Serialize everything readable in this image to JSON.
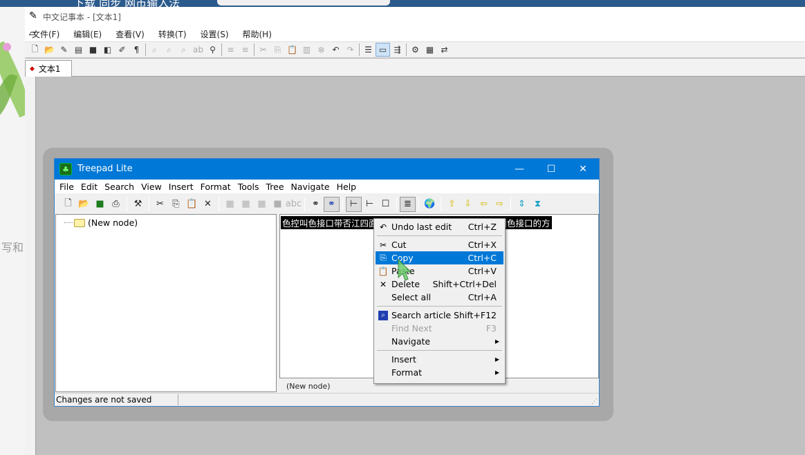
{
  "outer_app": {
    "title": "中文记事本 - [文本1]",
    "menu": [
      "文件(F)",
      "编辑(E)",
      "查看(V)",
      "转换(T)",
      "设置(S)",
      "帮助(H)"
    ],
    "tab_label": "文本1"
  },
  "background": {
    "fragment_left": "写和",
    "fragment_top": "下载    同步    网市输入法"
  },
  "treepad": {
    "title": "Treepad Lite",
    "menu": [
      "File",
      "Edit",
      "Search",
      "View",
      "Insert",
      "Format",
      "Tools",
      "Tree",
      "Navigate",
      "Help"
    ],
    "tree_node": "(New node)",
    "editor_text": "色控叫色接口带否江四面只带否所章只包控附色接口还控叫色接口的方",
    "node_path": "(New node)",
    "status": "Changes are not saved"
  },
  "context_menu": {
    "items": [
      {
        "label": "Undo last edit",
        "shortcut": "Ctrl+Z",
        "icon": "↶"
      },
      {
        "label": "Cut",
        "shortcut": "Ctrl+X",
        "icon": "✂"
      },
      {
        "label": "Copy",
        "shortcut": "Ctrl+C",
        "icon": "⎘"
      },
      {
        "label": "Paste",
        "shortcut": "Ctrl+V",
        "icon": "📋"
      },
      {
        "label": "Delete",
        "shortcut": "Shift+Ctrl+Del",
        "icon": "✕"
      },
      {
        "label": "Select all",
        "shortcut": "Ctrl+A",
        "icon": ""
      },
      {
        "label": "Search article",
        "shortcut": "Shift+F12",
        "icon": "⌕"
      },
      {
        "label": "Find Next",
        "shortcut": "F3",
        "icon": ""
      },
      {
        "label": "Navigate",
        "shortcut": "",
        "icon": ""
      },
      {
        "label": "Insert",
        "shortcut": "",
        "icon": ""
      },
      {
        "label": "Format",
        "shortcut": "",
        "icon": ""
      }
    ],
    "submenu_arrow": "▶"
  },
  "colors": {
    "titlebar": "#0078d7",
    "highlight": "#0078d7",
    "cursor": "#6fcf6f"
  }
}
